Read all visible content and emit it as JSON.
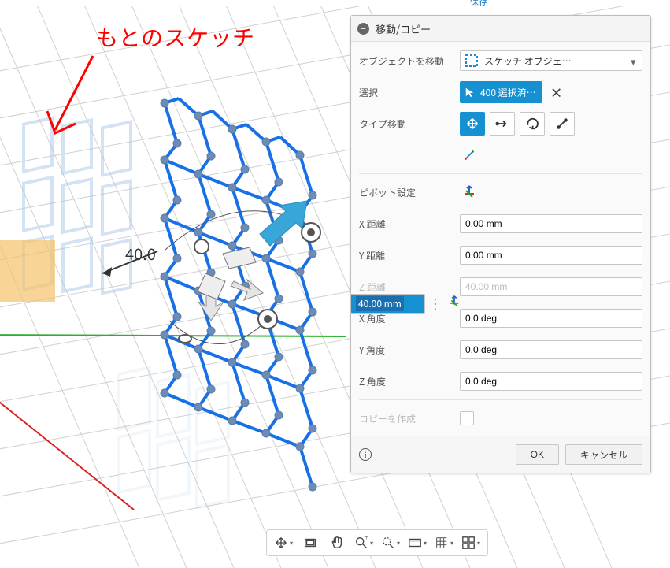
{
  "annotation": {
    "label": "もとのスケッチ"
  },
  "viewport": {
    "distance_label": "40.0"
  },
  "top_strip": {
    "link": "保存"
  },
  "dialog": {
    "title": "移動/コピー",
    "object_label": "オブジェクトを移動",
    "object_value": "スケッチ オブジェ…",
    "select_label": "選択",
    "select_value": "400 選択済…",
    "type_label": "タイプ移動",
    "pivot_label": "ピボット設定",
    "x_dist_label": "X 距離",
    "x_dist_value": "0.00 mm",
    "y_dist_label": "Y 距離",
    "y_dist_value": "0.00 mm",
    "z_dist_label": "Z 距離",
    "z_dist_value": "40.00 mm",
    "z_floating_value": "40.00 mm",
    "x_angle_label": "X 角度",
    "x_angle_value": "0.0 deg",
    "y_angle_label": "Y 角度",
    "y_angle_value": "0.0 deg",
    "z_angle_label": "Z 角度",
    "z_angle_value": "0.0 deg",
    "copy_label": "コピーを作成"
  },
  "footer": {
    "ok": "OK",
    "cancel": "キャンセル"
  }
}
